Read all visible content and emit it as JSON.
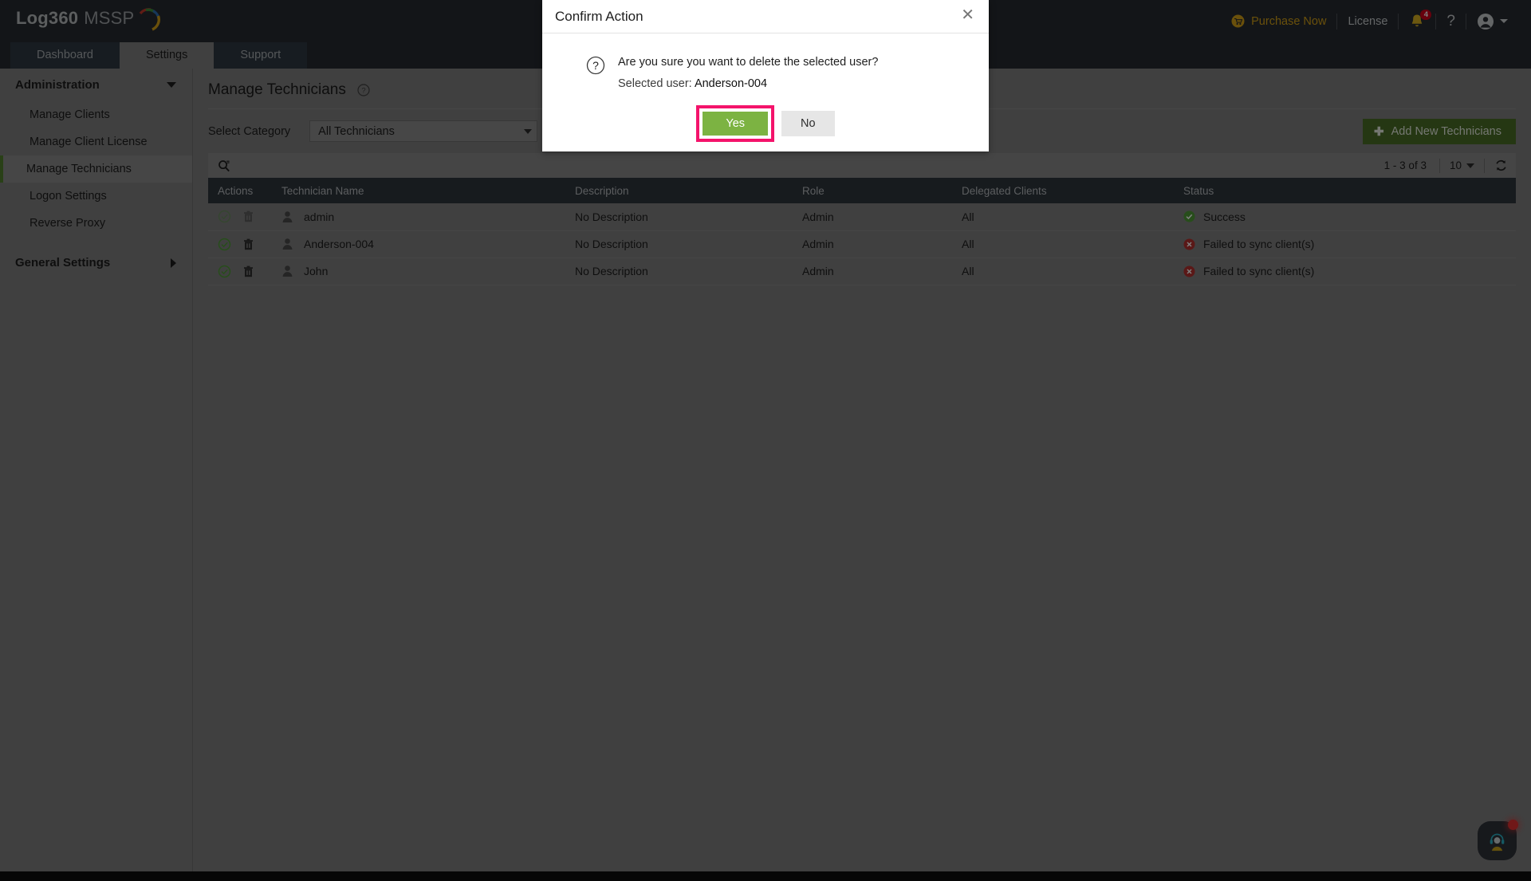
{
  "header": {
    "logo_primary": "Log360",
    "logo_secondary": "MSSP",
    "purchase_label": "Purchase Now",
    "license_label": "License",
    "notification_count": "4",
    "help_glyph": "?",
    "icons": {
      "cart": "cart-icon",
      "bell": "bell-icon",
      "help": "help-icon",
      "avatar": "avatar-icon"
    }
  },
  "tabs": [
    {
      "label": "Dashboard",
      "active": false
    },
    {
      "label": "Settings",
      "active": true
    },
    {
      "label": "Support",
      "active": false
    }
  ],
  "sidebar": {
    "groups": [
      {
        "label": "Administration",
        "expanded": true
      },
      {
        "label": "General Settings",
        "expanded": false
      }
    ],
    "items": [
      {
        "label": "Manage Clients",
        "active": false
      },
      {
        "label": "Manage Client License",
        "active": false
      },
      {
        "label": "Manage Technicians",
        "active": true
      },
      {
        "label": "Logon Settings",
        "active": false
      },
      {
        "label": "Reverse Proxy",
        "active": false
      }
    ]
  },
  "main": {
    "page_title": "Manage Technicians",
    "filter_label": "Select Category",
    "category_value": "All Technicians",
    "add_button_label": "Add New Technicians",
    "add_button_plus": "✚",
    "toolbar": {
      "pagination_text": "1 - 3 of 3",
      "page_size": "10"
    },
    "table": {
      "columns": [
        "Actions",
        "Technician Name",
        "Description",
        "Role",
        "Delegated Clients",
        "Status"
      ],
      "rows": [
        {
          "name": "admin",
          "description": "No Description",
          "role": "Admin",
          "delegated_clients": "All",
          "status": "Success",
          "status_type": "success",
          "actions_disabled": true
        },
        {
          "name": "Anderson-004",
          "description": "No Description",
          "role": "Admin",
          "delegated_clients": "All",
          "status": "Failed to sync client(s)",
          "status_type": "error",
          "actions_disabled": false
        },
        {
          "name": "John",
          "description": "No Description",
          "role": "Admin",
          "delegated_clients": "All",
          "status": "Failed to sync client(s)",
          "status_type": "error",
          "actions_disabled": false
        }
      ]
    }
  },
  "modal": {
    "title": "Confirm Action",
    "close_glyph": "✕",
    "message": "Are you sure you want to delete the selected user?",
    "selected_label": "Selected user:",
    "selected_value": "Anderson-004",
    "yes_label": "Yes",
    "no_label": "No",
    "highlight_color": "#f4136b"
  },
  "colors": {
    "header_bg": "#262b30",
    "tab_active_bg": "#818181",
    "accent_green": "#4b6e26",
    "yes_green": "#7cb342",
    "purchase_gold": "#d4a017",
    "badge_red": "#d0021b",
    "status_success": "#4f9a36",
    "status_error": "#b5302e"
  },
  "chat_widget": {
    "name": "support-chat",
    "has_notification": true
  }
}
